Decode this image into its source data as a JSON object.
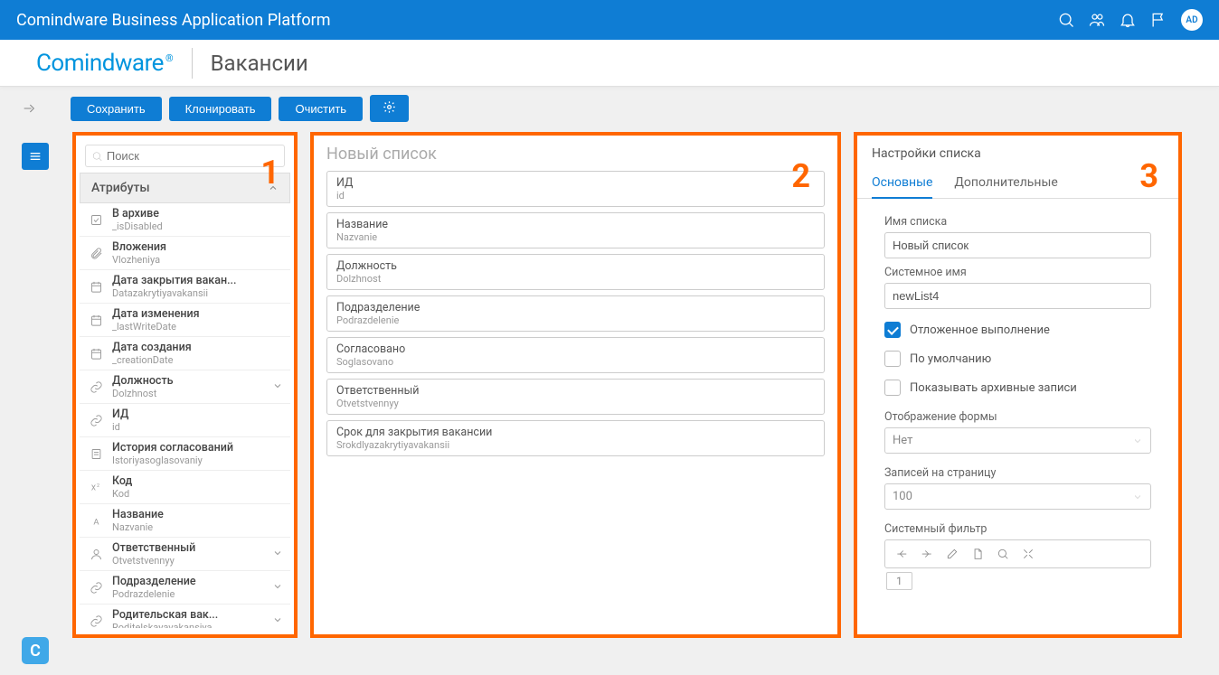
{
  "topbar": {
    "title": "Comindware Business Application Platform",
    "avatar": "AD"
  },
  "header": {
    "logo": "Comindware",
    "page_title": "Вакансии"
  },
  "toolbar": {
    "save": "Сохранить",
    "clone": "Клонировать",
    "clear": "Очистить"
  },
  "panel_numbers": {
    "p1": "1",
    "p2": "2",
    "p3": "3"
  },
  "panel1": {
    "search_placeholder": "Поиск",
    "section_title": "Атрибуты",
    "attrs": [
      {
        "icon": "checkbox",
        "label": "В архиве",
        "sub": "_isDisabled",
        "expand": false
      },
      {
        "icon": "clip",
        "label": "Вложения",
        "sub": "Vlozheniya",
        "expand": false
      },
      {
        "icon": "cal",
        "label": "Дата закрытия вакан...",
        "sub": "Datazakrytiyavakansii",
        "expand": false
      },
      {
        "icon": "cal",
        "label": "Дата изменения",
        "sub": "_lastWriteDate",
        "expand": false
      },
      {
        "icon": "cal",
        "label": "Дата создания",
        "sub": "_creationDate",
        "expand": false
      },
      {
        "icon": "link",
        "label": "Должность",
        "sub": "Dolzhnost",
        "expand": true
      },
      {
        "icon": "link",
        "label": "ИД",
        "sub": "id",
        "expand": false
      },
      {
        "icon": "doc",
        "label": "История согласований",
        "sub": "Istoriyasoglasovaniy",
        "expand": false
      },
      {
        "icon": "x2",
        "label": "Код",
        "sub": "Kod",
        "expand": false
      },
      {
        "icon": "A",
        "label": "Название",
        "sub": "Nazvanie",
        "expand": false
      },
      {
        "icon": "user",
        "label": "Ответственный",
        "sub": "Otvetstvennyy",
        "expand": true
      },
      {
        "icon": "link",
        "label": "Подразделение",
        "sub": "Podrazdelenie",
        "expand": true
      },
      {
        "icon": "link",
        "label": "Родительская вак...",
        "sub": "Roditelskayavakansiya",
        "expand": true
      }
    ]
  },
  "panel2": {
    "title": "Новый список",
    "fields": [
      {
        "label": "ИД",
        "sub": "id"
      },
      {
        "label": "Название",
        "sub": "Nazvanie"
      },
      {
        "label": "Должность",
        "sub": "Dolzhnost"
      },
      {
        "label": "Подразделение",
        "sub": "Podrazdelenie"
      },
      {
        "label": "Согласовано",
        "sub": "Soglasovano"
      },
      {
        "label": "Ответственный",
        "sub": "Otvetstvennyy"
      },
      {
        "label": "Срок для закрытия вакансии",
        "sub": "Srokdlyazakrytiyavakansii"
      }
    ]
  },
  "panel3": {
    "title": "Настройки списка",
    "tabs": {
      "main": "Основные",
      "extra": "Дополнительные"
    },
    "labels": {
      "list_name": "Имя списка",
      "system_name": "Системное имя",
      "delayed": "Отложенное выполнение",
      "default": "По умолчанию",
      "show_archived": "Показывать архивные записи",
      "form_display": "Отображение формы",
      "records_per_page": "Записей на страницу",
      "system_filter": "Системный фильтр"
    },
    "values": {
      "list_name": "Новый список",
      "system_name": "newList4",
      "form_display": "Нет",
      "records_per_page": "100",
      "filter_num": "1"
    },
    "checks": {
      "delayed": true,
      "default": false,
      "show_archived": false
    }
  }
}
